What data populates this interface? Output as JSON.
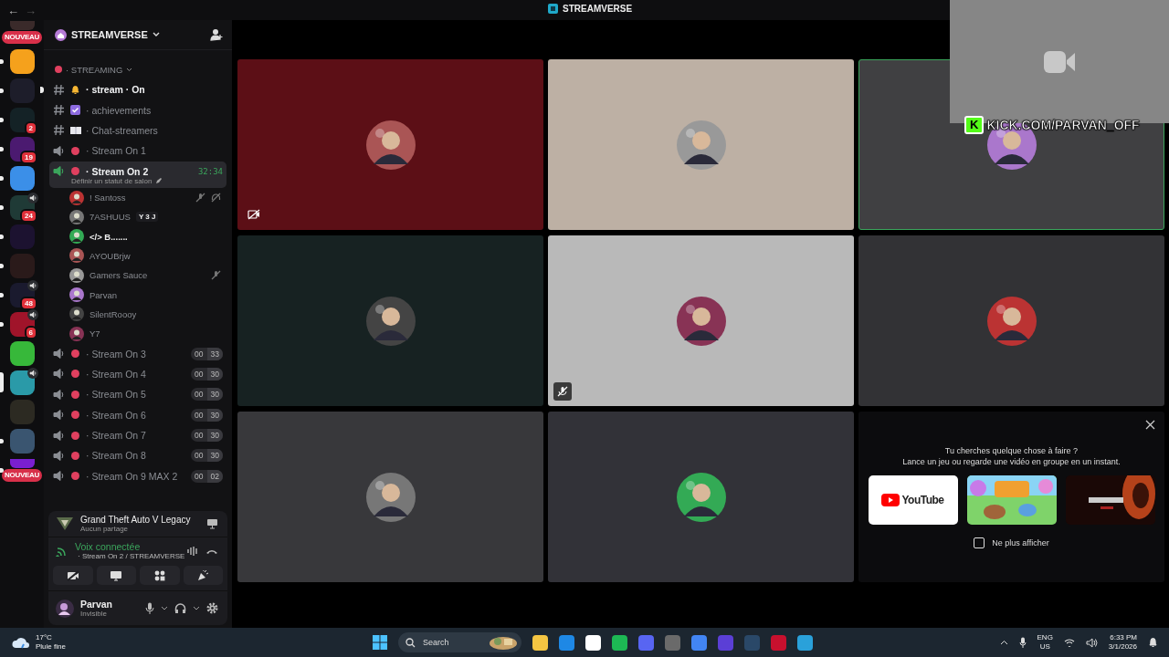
{
  "titlebar": {
    "back": "←",
    "forward": "→",
    "title": "STREAMVERSE"
  },
  "servers": [
    {
      "color": "#3a2a2a",
      "tag": "NOUVEAU",
      "speaker": false,
      "unread": false,
      "selected": false
    },
    {
      "color": "#f5a11c",
      "speaker": false,
      "unread": true,
      "selected": false
    },
    {
      "color": "#1d1d2a",
      "speaker": false,
      "unread": true,
      "selected": false
    },
    {
      "color": "#142226",
      "badge": "2",
      "speaker": false,
      "unread": true,
      "selected": false
    },
    {
      "color": "#4b1a70",
      "badge": "19",
      "speaker": false,
      "unread": true,
      "selected": false
    },
    {
      "color": "#3b8fe8",
      "speaker": false,
      "unread": true,
      "selected": false
    },
    {
      "color": "#1f3a36",
      "badge": "24",
      "speaker": true,
      "unread": true,
      "selected": false
    },
    {
      "color": "#1c1230",
      "speaker": false,
      "unread": true,
      "selected": false
    },
    {
      "color": "#2a1a1a",
      "speaker": false,
      "unread": true,
      "selected": false
    },
    {
      "color": "#1a1a2e",
      "badge": "48",
      "speaker": true,
      "unread": true,
      "selected": false
    },
    {
      "color": "#a0142a",
      "badge": "6",
      "speaker": true,
      "unread": true,
      "selected": false
    },
    {
      "color": "#37b83a",
      "speaker": false,
      "unread": false,
      "selected": false
    },
    {
      "color": "#2a9aa8",
      "speaker": true,
      "unread": false,
      "selected": true
    },
    {
      "color": "#2c2a22",
      "speaker": false,
      "unread": false,
      "selected": false
    },
    {
      "color": "#3a5570",
      "speaker": false,
      "unread": true,
      "selected": false
    },
    {
      "color": "#7a1fd0",
      "tag": "NOUVEAU",
      "speaker": false,
      "unread": true,
      "selected": false
    }
  ],
  "guild": {
    "name": "STREAMVERSE"
  },
  "category": {
    "name": "· STREAMING"
  },
  "channels": [
    {
      "kind": "text",
      "name": "· stream · On",
      "unread": true,
      "selected": false
    },
    {
      "kind": "text",
      "name": "· achievements",
      "unread": false,
      "selected": false
    },
    {
      "kind": "text",
      "name": "· Chat-streamers",
      "unread": false,
      "selected": false
    },
    {
      "kind": "voice",
      "name": "· Stream On 1",
      "unread": false,
      "selected": false
    },
    {
      "kind": "voice",
      "name": "· Stream On 2",
      "unread": true,
      "selected": true,
      "timer": "32:34",
      "status": "Définir un statut de salon",
      "members": [
        {
          "name": "! Santoss",
          "muted": true,
          "deafened": true
        },
        {
          "name": "7ASHUUS",
          "tag": "Y 3 J",
          "muted": false,
          "deafened": false
        },
        {
          "name": "</> B.......",
          "bold": true,
          "muted": false,
          "deafened": false
        },
        {
          "name": "AYOUBrjw",
          "muted": false,
          "deafened": false
        },
        {
          "name": "Gamers Sauce",
          "muted": true,
          "deafened": false
        },
        {
          "name": "Parvan",
          "muted": false,
          "deafened": false
        },
        {
          "name": "SilentRoooy",
          "muted": false,
          "deafened": false
        },
        {
          "name": "Y7",
          "muted": false,
          "deafened": false
        }
      ]
    },
    {
      "kind": "voice",
      "name": "· Stream On 3",
      "unread": false,
      "selected": false,
      "count": "00",
      "limit": "33"
    },
    {
      "kind": "voice",
      "name": "· Stream On 4",
      "unread": false,
      "selected": false,
      "count": "00",
      "limit": "30"
    },
    {
      "kind": "voice",
      "name": "· Stream On 5",
      "unread": false,
      "selected": false,
      "count": "00",
      "limit": "30"
    },
    {
      "kind": "voice",
      "name": "· Stream On 6",
      "unread": false,
      "selected": false,
      "count": "00",
      "limit": "30"
    },
    {
      "kind": "voice",
      "name": "· Stream On 7",
      "unread": false,
      "selected": false,
      "count": "00",
      "limit": "30"
    },
    {
      "kind": "voice",
      "name": "· Stream On 8",
      "unread": false,
      "selected": false,
      "count": "00",
      "limit": "30"
    },
    {
      "kind": "voice",
      "name": "· Stream On 9 MAX 2",
      "unread": false,
      "selected": false,
      "count": "00",
      "limit": "02"
    }
  ],
  "activity": {
    "game": "Grand Theft Auto V Legacy",
    "status": "Aucun partage"
  },
  "voice": {
    "state": "Voix connectée",
    "channel": "· Stream On 2 / STREAMVERSE"
  },
  "user": {
    "name": "Parvan",
    "status": "Invisible"
  },
  "tiles": [
    {
      "color": "#5c0f16",
      "speaking": false,
      "camera_off": true,
      "muted": false
    },
    {
      "color": "#bdb0a4",
      "speaking": false,
      "camera_off": false,
      "muted": false
    },
    {
      "color": "#404042",
      "speaking": true,
      "camera_off": false,
      "muted": false
    },
    {
      "color": "#172222",
      "speaking": false,
      "camera_off": false,
      "muted": false
    },
    {
      "color": "#b9b9b9",
      "speaking": false,
      "camera_off": false,
      "muted": true
    },
    {
      "color": "#323235",
      "speaking": false,
      "camera_off": false,
      "muted": false
    },
    {
      "color": "#38383b",
      "speaking": false,
      "camera_off": false,
      "muted": false
    },
    {
      "color": "#323238",
      "speaking": false,
      "camera_off": false,
      "muted": false
    }
  ],
  "promo": {
    "title": "Tu cherches quelque chose à faire ?",
    "subtitle": "Lance un jeu ou regarde une vidéo en groupe en un instant.",
    "cards": [
      {
        "kind": "youtube",
        "label": "YouTube"
      },
      {
        "kind": "picture"
      },
      {
        "kind": "picture"
      }
    ],
    "opt_out": {
      "label": "Ne plus afficher",
      "checked": false
    }
  },
  "kick": {
    "logo": "K",
    "url": "KICK.COM/PARVAN_OFF"
  },
  "taskbar": {
    "temperature": "17°C",
    "weather": "Pluie fine",
    "search": "Search",
    "language": "ENG",
    "region": "US",
    "time": "6:33 PM",
    "date": "3/1/2026"
  }
}
